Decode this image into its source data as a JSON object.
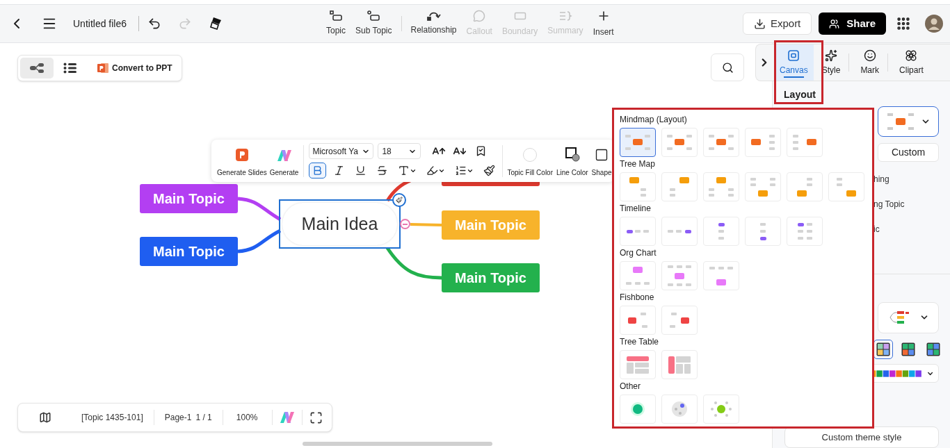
{
  "top_bar": {
    "file_name": "Untitled file6",
    "history": [
      {
        "kind": "undo",
        "disabled": false
      },
      {
        "kind": "redo",
        "disabled": true
      }
    ],
    "tools": [
      {
        "label": "Topic",
        "kind": "topic",
        "disabled": false
      },
      {
        "label": "Sub Topic",
        "kind": "subtopic",
        "disabled": false
      },
      {
        "label": "Relationship",
        "kind": "relationship",
        "disabled": false
      },
      {
        "label": "Callout",
        "kind": "callout",
        "disabled": true
      },
      {
        "label": "Boundary",
        "kind": "boundary",
        "disabled": true
      },
      {
        "label": "Summary",
        "kind": "summary",
        "disabled": true
      },
      {
        "label": "Insert",
        "kind": "insert",
        "disabled": false
      }
    ],
    "export": "Export",
    "share": "Share"
  },
  "view_switch": {
    "modes": [
      {
        "kind": "mindmap",
        "selected": true
      },
      {
        "kind": "outline",
        "selected": false
      }
    ],
    "convert": "Convert to PPT"
  },
  "mind_map": {
    "center": {
      "label": "Main Idea",
      "selected": true
    },
    "topics": [
      {
        "label": "Main Topic",
        "color": "#b33ff2"
      },
      {
        "label": "Main Topic",
        "color": "#1f5ef0"
      },
      {
        "color": "#e03a2f"
      },
      {
        "label": "Main Topic",
        "color": "#f7b32b"
      },
      {
        "label": "Main Topic",
        "color": "#23b14d"
      }
    ]
  },
  "format_toolbar": {
    "ai": [
      {
        "label": "Generate Slides",
        "kind": "slides"
      },
      {
        "label": "Generate",
        "kind": "generate"
      }
    ],
    "font": "Microsoft Ya",
    "size": "18",
    "styles": [
      {
        "kind": "bold",
        "selected": true
      },
      {
        "kind": "italic",
        "selected": false
      },
      {
        "kind": "underline",
        "selected": false
      },
      {
        "kind": "strike",
        "selected": false
      },
      {
        "kind": "color",
        "selected": false
      },
      {
        "kind": "highlight",
        "selected": false
      },
      {
        "kind": "list",
        "selected": false
      },
      {
        "kind": "painter",
        "selected": false
      }
    ],
    "fill": [
      {
        "label": "Topic Fill Color",
        "kind": "fill"
      },
      {
        "label": "Line Color",
        "kind": "line"
      },
      {
        "label": "Shape",
        "kind": "shape"
      }
    ]
  },
  "side_panel": {
    "tabs": [
      {
        "label": "Canvas",
        "kind": "canvas",
        "selected": true
      },
      {
        "label": "Style",
        "kind": "style",
        "selected": false
      },
      {
        "label": "Mark",
        "kind": "mark",
        "selected": false
      },
      {
        "label": "Clipart",
        "kind": "clipart",
        "selected": false
      }
    ],
    "section": "Layout",
    "custom": "Custom",
    "partial_items": [
      "hing",
      "ng Topic",
      "ic"
    ],
    "color_schemes": [
      {
        "selected": true
      },
      {
        "selected": false
      },
      {
        "selected": false
      }
    ],
    "theme_button": "Custom theme style"
  },
  "layout_popup": {
    "groups": [
      {
        "title": "Mindmap (Layout)",
        "kind": "mindmap",
        "options": [
          {
            "selected": true
          },
          {
            "selected": false
          },
          {
            "selected": false
          },
          {
            "selected": false
          },
          {
            "selected": false
          }
        ]
      },
      {
        "title": "Tree Map",
        "kind": "tree",
        "options": [
          {
            "selected": false
          },
          {
            "selected": false
          },
          {
            "selected": false
          },
          {
            "selected": false
          },
          {
            "selected": false
          },
          {
            "selected": false
          }
        ]
      },
      {
        "title": "Timeline",
        "kind": "timeline",
        "options": [
          {
            "selected": false
          },
          {
            "selected": false
          },
          {
            "selected": false
          },
          {
            "selected": false
          },
          {
            "selected": false
          }
        ]
      },
      {
        "title": "Org Chart",
        "kind": "org",
        "options": [
          {
            "selected": false
          },
          {
            "selected": false
          },
          {
            "selected": false
          }
        ]
      },
      {
        "title": "Fishbone",
        "kind": "fishbone",
        "options": [
          {
            "selected": false
          },
          {
            "selected": false
          }
        ]
      },
      {
        "title": "Tree Table",
        "kind": "table",
        "options": [
          {
            "selected": false
          },
          {
            "selected": false
          }
        ]
      },
      {
        "title": "Other",
        "kind": "other",
        "options": [
          {
            "selected": false
          },
          {
            "selected": false
          },
          {
            "selected": false
          }
        ]
      }
    ]
  },
  "status_bar": {
    "topic": "[Topic 1435-101]",
    "page": "Page-1",
    "page_count": "1 / 1",
    "zoom": "100%"
  }
}
